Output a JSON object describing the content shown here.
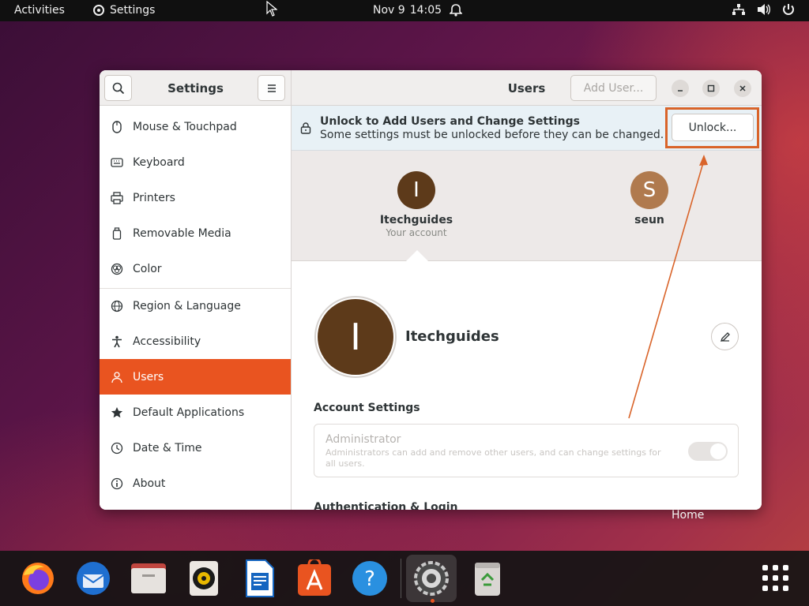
{
  "topbar": {
    "activities": "Activities",
    "app_name": "Settings",
    "date": "Nov 9",
    "time": "14:05"
  },
  "sidebar_header": {
    "title": "Settings",
    "search_icon": "search-icon",
    "menu_icon": "hamburger-menu-icon"
  },
  "header": {
    "title": "Users",
    "add_user_label": "Add User..."
  },
  "sidebar": {
    "items": [
      {
        "label": "Mouse & Touchpad",
        "icon": "mouse-icon"
      },
      {
        "label": "Keyboard",
        "icon": "keyboard-icon"
      },
      {
        "label": "Printers",
        "icon": "printer-icon"
      },
      {
        "label": "Removable Media",
        "icon": "removable-media-icon"
      },
      {
        "label": "Color",
        "icon": "color-icon"
      },
      {
        "label": "Region & Language",
        "icon": "globe-icon"
      },
      {
        "label": "Accessibility",
        "icon": "accessibility-icon"
      },
      {
        "label": "Users",
        "icon": "users-icon"
      },
      {
        "label": "Default Applications",
        "icon": "star-icon"
      },
      {
        "label": "Date & Time",
        "icon": "clock-icon"
      },
      {
        "label": "About",
        "icon": "info-icon"
      }
    ],
    "active_index": 7
  },
  "banner": {
    "title": "Unlock to Add Users and Change Settings",
    "subtitle": "Some settings must be unlocked before they can be changed.",
    "unlock_label": "Unlock..."
  },
  "users": [
    {
      "initial": "I",
      "name": "Itechguides",
      "subtitle": "Your account",
      "color": "#5d3a1a"
    },
    {
      "initial": "S",
      "name": "seun",
      "subtitle": "",
      "color": "#b07a4e"
    }
  ],
  "account": {
    "initial": "I",
    "name": "Itechguides",
    "section_title": "Account Settings",
    "admin_title": "Administrator",
    "admin_desc": "Administrators can add and remove other users, and can change settings for all users.",
    "admin_enabled": true,
    "section2_title": "Authentication & Login"
  },
  "desktop": {
    "home_label": "Home"
  },
  "dock": {
    "apps": [
      "firefox-icon",
      "thunderbird-icon",
      "files-icon",
      "rhythmbox-icon",
      "libreoffice-writer-icon",
      "software-center-icon",
      "help-icon",
      "settings-icon",
      "trash-icon"
    ]
  },
  "colors": {
    "accent": "#e95420",
    "highlight": "#d9642a"
  }
}
